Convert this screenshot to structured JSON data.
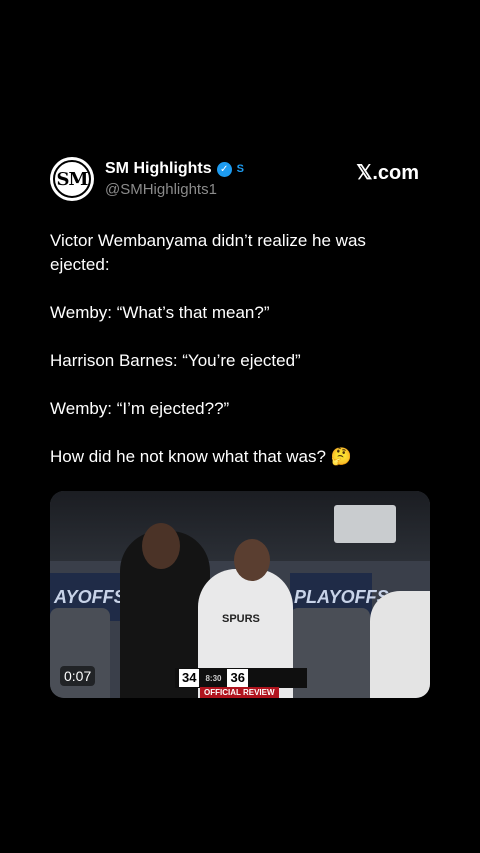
{
  "author": {
    "display_name": "SM Highlights",
    "handle": "@SMHighlights1",
    "avatar_text": "SM",
    "affiliate_badge": "S"
  },
  "site_label": "𝕏.com",
  "tweet": {
    "text": "Victor Wembanyama didn’t realize he was ejected:\n\nWemby: “What’s that mean?”\n\nHarrison Barnes: “You’re ejected”\n\nWemby: “I’m ejected??”\n\nHow did he not know what that was? 🤔"
  },
  "media": {
    "duration": "0:07",
    "scoreboard": {
      "away_score": "34",
      "home_score": "36",
      "clock": "8:30",
      "banner": "OFFICIAL REVIEW"
    },
    "signage_left": "AYOFFS",
    "signage_right": "PLAYOFFS",
    "jersey": "SPURS"
  },
  "colors": {
    "verified": "#1d9bf0",
    "background": "#000000",
    "handle": "#8b8b8b"
  }
}
